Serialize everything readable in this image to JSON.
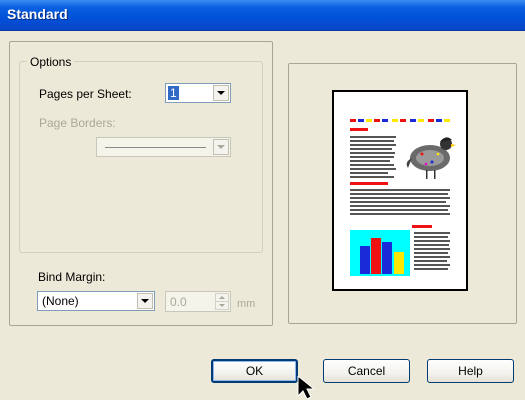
{
  "window": {
    "title": "Standard"
  },
  "options": {
    "group_label": "Options",
    "pages_per_sheet": {
      "label": "Pages per Sheet:",
      "value": "1"
    },
    "page_borders": {
      "label": "Page Borders:"
    }
  },
  "bind_margin": {
    "label": "Bind Margin:",
    "value": "(None)",
    "amount": "0.0",
    "unit": "mm"
  },
  "buttons": {
    "ok": "OK",
    "cancel": "Cancel",
    "help": "Help"
  },
  "colors": {
    "title_blue": "#0a5fe0",
    "selection": "#316ac5",
    "preview_red": "#ee1111",
    "preview_yellow": "#ffe800",
    "preview_cyan": "#00ffff",
    "preview_blue": "#1a2ad8",
    "preview_magenta": "#ee00cc"
  },
  "icons": [
    "dropdown-arrow-icon",
    "spin-up-icon",
    "spin-down-icon",
    "mouse-pointer-icon",
    "quail-bird-icon"
  ]
}
